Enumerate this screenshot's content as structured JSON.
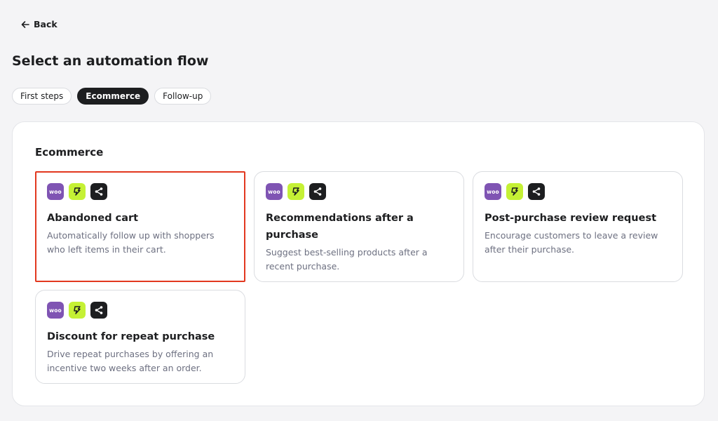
{
  "header": {
    "back_label": "Back",
    "title": "Select an automation flow"
  },
  "tabs": [
    {
      "label": "First steps",
      "active": false
    },
    {
      "label": "Ecommerce",
      "active": true
    },
    {
      "label": "Follow-up",
      "active": false
    }
  ],
  "section": {
    "title": "Ecommerce"
  },
  "integration_icons": {
    "woo_text": "woo",
    "names": [
      "woocommerce-icon",
      "lightning-logo-icon",
      "share-icon"
    ],
    "colors": {
      "woo": "#7f54b3",
      "lime": "#c5f135",
      "share": "#1d1e20"
    }
  },
  "cards": [
    {
      "title": "Abandoned cart",
      "description": "Automatically follow up with shoppers who left items in their cart.",
      "selected": true
    },
    {
      "title": "Recommendations after a purchase",
      "description": "Suggest best-selling products after a recent purchase.",
      "selected": false
    },
    {
      "title": "Post-purchase review request",
      "description": "Encourage customers to leave a review after their purchase.",
      "selected": false
    },
    {
      "title": "Discount for repeat purchase",
      "description": "Drive repeat purchases by offering an incentive two weeks after an order.",
      "selected": false
    }
  ],
  "colors": {
    "selected_border": "#e2381f",
    "active_tab_bg": "#1d1e20"
  }
}
